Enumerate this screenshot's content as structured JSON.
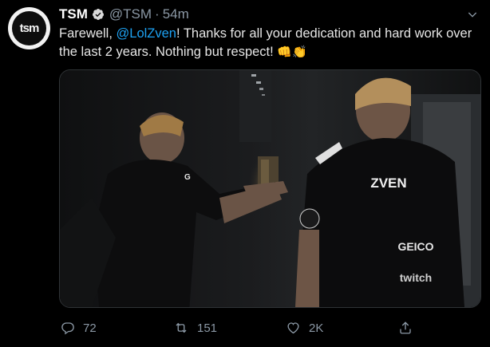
{
  "tweet": {
    "author_name": "TSM",
    "author_handle": "@TSM",
    "separator": "·",
    "timestamp": "54m",
    "avatar_text": "tsm",
    "text_before": "Farewell, ",
    "mention": "@LolZven",
    "text_after": "! Thanks for all your dedication and hard work over the last 2 years. Nothing but respect! ",
    "emojis": "👊👏",
    "jersey_name": "ZVEN",
    "sponsor_1": "GEICO",
    "sponsor_2": "twitch"
  },
  "actions": {
    "reply_count": "72",
    "retweet_count": "151",
    "like_count": "2K"
  },
  "colors": {
    "background": "#000000",
    "link": "#1da1f2",
    "muted": "#8b98a5"
  }
}
